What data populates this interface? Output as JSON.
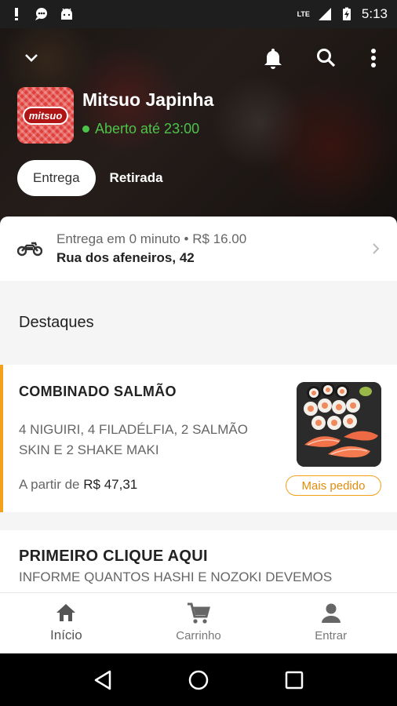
{
  "status_bar": {
    "time": "5:13",
    "network": "LTE",
    "icons": [
      "alert-icon",
      "chat-icon",
      "android-icon",
      "signal-icon",
      "battery-charging-icon"
    ]
  },
  "header": {
    "store_name": "Mitsuo Japinha",
    "logo_text": "mitsuo",
    "open_status": "Aberto até 23:00",
    "icons": [
      "chevron-down-icon",
      "bell-icon",
      "search-icon",
      "more-vertical-icon"
    ],
    "modes": {
      "active": "Entrega",
      "inactive": "Retirada"
    }
  },
  "delivery": {
    "line1": "Entrega em 0 minuto • R$ 16.00",
    "address": "Rua dos afeneiros, 42",
    "icon": "motorcycle-icon"
  },
  "highlights": {
    "title": "Destaques"
  },
  "products": [
    {
      "name": "COMBINADO SALMÃO",
      "description": "4 NIGUIRI, 4 FILADÉLFIA, 2 SALMÃO SKIN E 2 SHAKE MAKI",
      "price_prefix": "A partir de",
      "price": "R$ 47,31",
      "badge": "Mais pedido"
    },
    {
      "name": "PRIMEIRO CLIQUE AQUI",
      "description": "INFORME QUANTOS HASHI E NOZOKI DEVEMOS"
    }
  ],
  "bottom_nav": [
    {
      "label": "Início",
      "icon": "home-icon"
    },
    {
      "label": "Carrinho",
      "icon": "cart-icon"
    },
    {
      "label": "Entrar",
      "icon": "user-icon"
    }
  ],
  "colors": {
    "accent": "#f3a01a",
    "open_green": "#4cc34a",
    "logo_red": "#e0403c"
  }
}
